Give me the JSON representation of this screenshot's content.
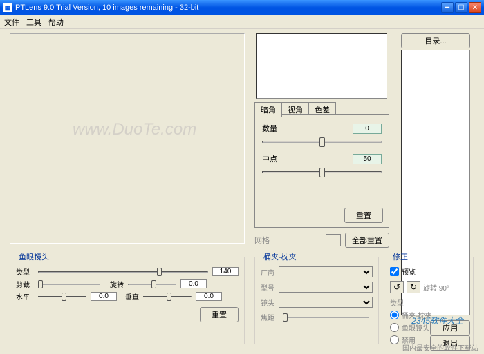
{
  "title": "PTLens 9.0 Trial Version, 10 images remaining - 32-bit",
  "menu": {
    "file": "文件",
    "tools": "工具",
    "help": "帮助"
  },
  "btn_dir": "目录...",
  "btn_apply": "应用",
  "btn_exit": "退出",
  "tabs": {
    "vignette": "暗角",
    "view": "视角",
    "ca": "色差"
  },
  "vignette": {
    "amount_lbl": "数量",
    "amount_val": "0",
    "mid_lbl": "中点",
    "mid_val": "50",
    "reset": "重置"
  },
  "grid": {
    "lbl": "网格",
    "resetall": "全部重置"
  },
  "fisheye": {
    "legend": "鱼眼镜头",
    "type_lbl": "类型",
    "type_val": "140",
    "crop_lbl": "剪裁",
    "rot_lbl": "旋转",
    "rot_val": "0.0",
    "horiz_lbl": "水平",
    "horiz_val": "0.0",
    "vert_lbl": "垂直",
    "vert_val": "0.0",
    "reset": "重置"
  },
  "barrel": {
    "legend": "桶夹-枕夹",
    "maker_lbl": "厂商",
    "model_lbl": "型号",
    "lens_lbl": "镜头",
    "focal_lbl": "焦距"
  },
  "correct": {
    "legend": "修正",
    "preview": "预览",
    "rotate90": "旋转 90°",
    "type_lbl": "类型",
    "opt_barrel": "桶夹-枕夹",
    "opt_fisheye": "鱼眼镜头",
    "opt_disable": "禁用"
  },
  "watermark": "www.DuoTe.com",
  "footer": "国内最安全的软件下载站",
  "brand": "2345软件大全"
}
